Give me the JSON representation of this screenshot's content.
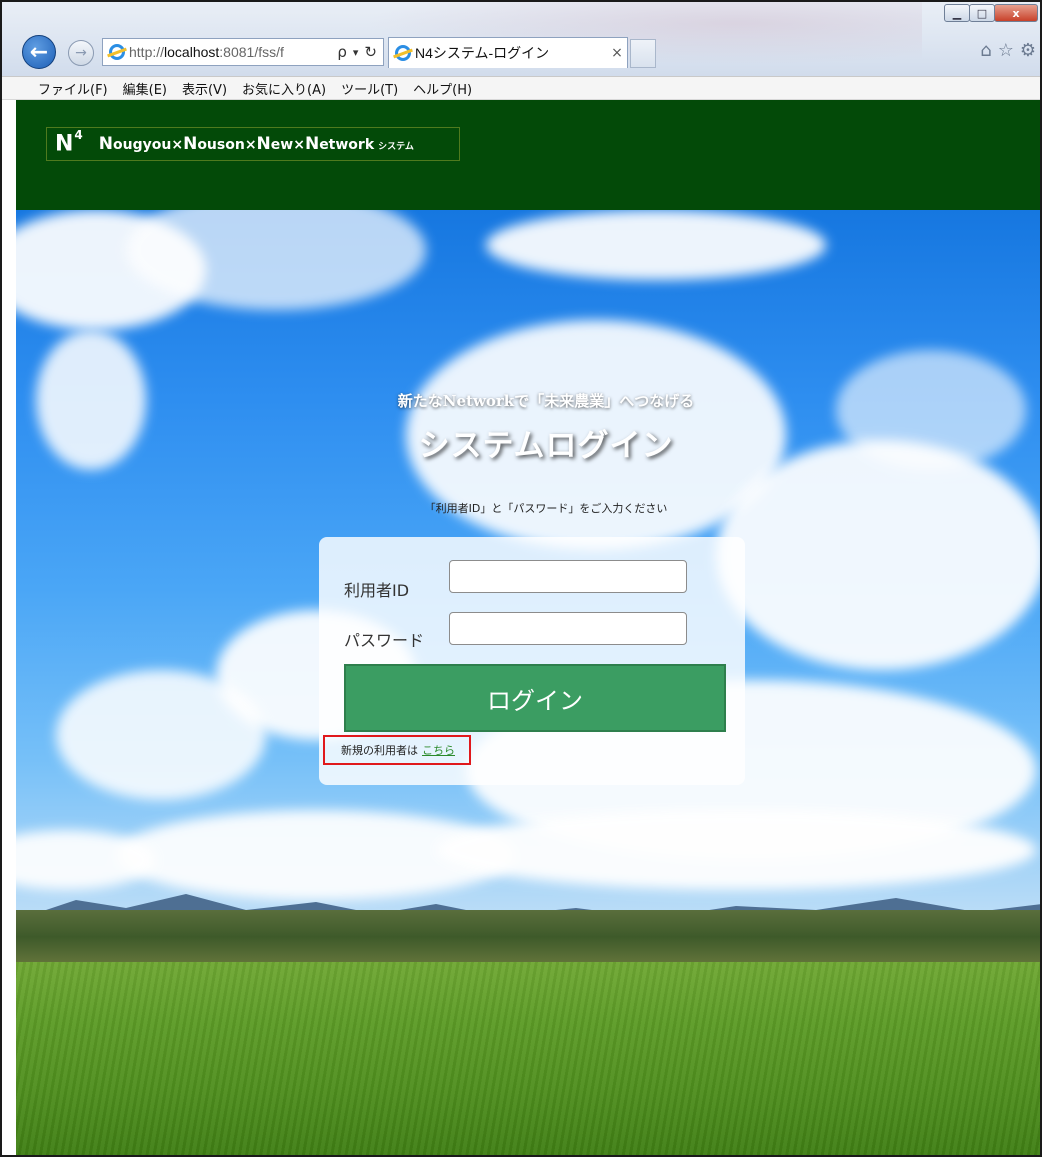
{
  "browser": {
    "url_prefix": "http://",
    "url_host": "localhost",
    "url_rest": ":8081/fss/f",
    "search_glyph": "ρ",
    "dropdown_glyph": "▾",
    "refresh_glyph": "↻",
    "tab_title": "N4システム-ログイン",
    "tab_close": "×",
    "back_glyph": "←",
    "forward_glyph": "→",
    "min_glyph": "▁",
    "max_glyph": "□",
    "close_glyph": "x",
    "home_glyph": "⌂",
    "fav_glyph": "☆",
    "tools_glyph": "⚙"
  },
  "menu": [
    "ファイル(F)",
    "編集(E)",
    "表示(V)",
    "お気に入り(A)",
    "ツール(T)",
    "ヘルプ(H)"
  ],
  "header": {
    "logo_mark": "N",
    "logo_sup": "4",
    "logo_parts": [
      "N",
      "ougyou×",
      "N",
      "ouson×",
      "N",
      "ew×",
      "N",
      "etwork"
    ],
    "logo_suffix": "システム"
  },
  "hero": {
    "tagline": "新たなNetworkで「未来農業」へつなげる",
    "title": "システムログイン",
    "instruction": "「利用者ID」と「パスワード」をご入力ください"
  },
  "form": {
    "user_id_label": "利用者ID",
    "user_id_value": "",
    "password_label": "パスワード",
    "password_value": "",
    "login_button": "ログイン",
    "register_text": "新規の利用者は",
    "register_link": "こちら"
  },
  "colors": {
    "header_bg": "#034a08",
    "login_button": "#3b9d62",
    "register_highlight": "#e0181c",
    "link": "#2a8a2a"
  }
}
